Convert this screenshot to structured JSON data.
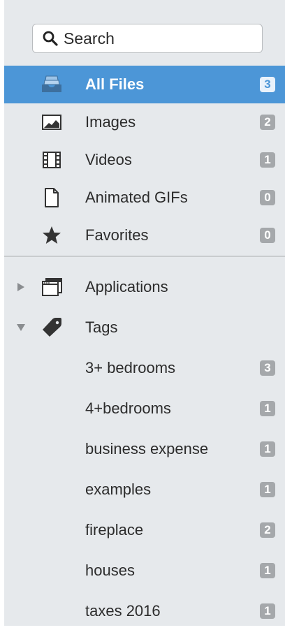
{
  "search": {
    "placeholder": "Search",
    "icon": "search-icon"
  },
  "library": {
    "items": [
      {
        "label": "All Files",
        "count": "3",
        "icon": "tray-icon",
        "selected": true
      },
      {
        "label": "Images",
        "count": "2",
        "icon": "image-icon"
      },
      {
        "label": "Videos",
        "count": "1",
        "icon": "film-icon"
      },
      {
        "label": "Animated GIFs",
        "count": "0",
        "icon": "document-icon"
      },
      {
        "label": "Favorites",
        "count": "0",
        "icon": "star-icon"
      }
    ]
  },
  "sources": {
    "applications": {
      "label": "Applications",
      "icon": "window-icon",
      "expanded": false
    },
    "tags": {
      "label": "Tags",
      "icon": "tag-icon",
      "expanded": true
    }
  },
  "tags": [
    {
      "label": "3+ bedrooms",
      "count": "3"
    },
    {
      "label": "4+bedrooms",
      "count": "1"
    },
    {
      "label": "business expense",
      "count": "1"
    },
    {
      "label": "examples",
      "count": "1"
    },
    {
      "label": "fireplace",
      "count": "2"
    },
    {
      "label": "houses",
      "count": "1"
    },
    {
      "label": "taxes 2016",
      "count": "1"
    }
  ],
  "colors": {
    "sidebar_bg": "#e6e9ec",
    "selection": "#4c96d7",
    "badge": "#a5a8ab",
    "icon": "#333333"
  }
}
